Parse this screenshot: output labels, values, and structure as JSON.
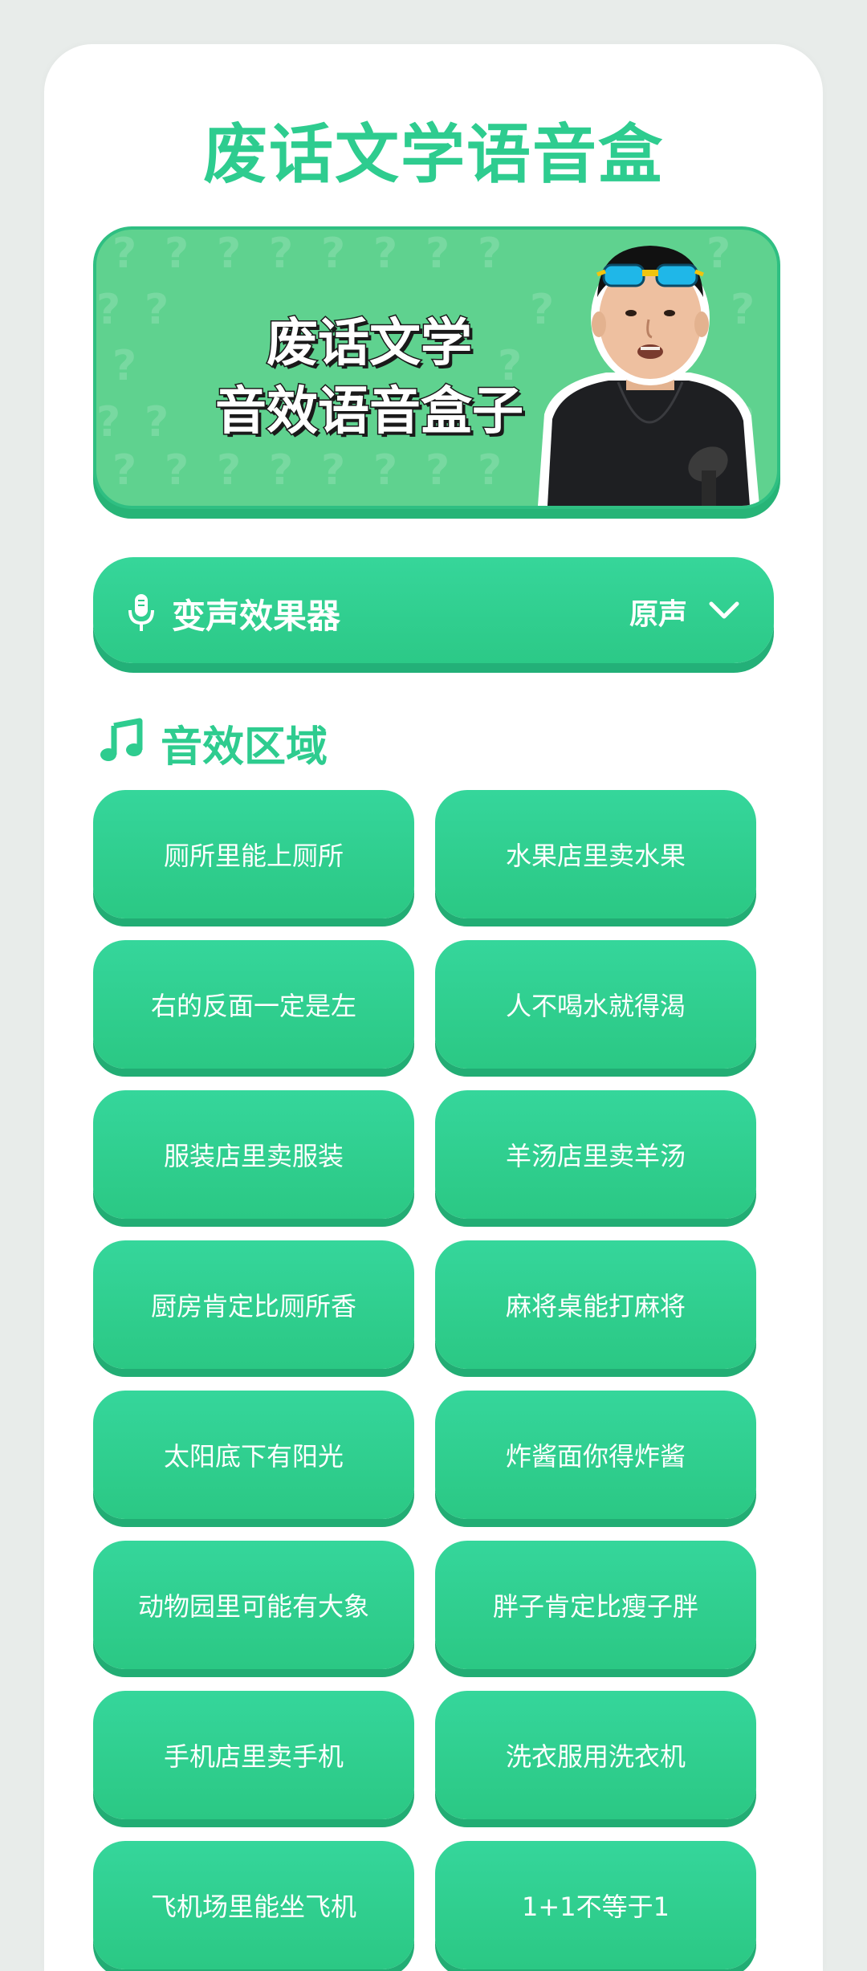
{
  "header": {
    "title": "废话文学语音盒"
  },
  "banner": {
    "line1": "废话文学",
    "line2": "音效语音盒子"
  },
  "voice_changer": {
    "label": "变声效果器",
    "value": "原声",
    "icon": "microphone-icon",
    "dropdown_icon": "chevron-down-icon"
  },
  "section": {
    "title": "音效区域",
    "icon": "music-note-icon"
  },
  "sounds": [
    "厕所里能上厕所",
    "水果店里卖水果",
    "右的反面一定是左",
    "人不喝水就得渴",
    "服装店里卖服装",
    "羊汤店里卖羊汤",
    "厨房肯定比厕所香",
    "麻将桌能打麻将",
    "太阳底下有阳光",
    "炸酱面你得炸酱",
    "动物园里可能有大象",
    "胖子肯定比瘦子胖",
    "手机店里卖手机",
    "洗衣服用洗衣机",
    "飞机场里能坐飞机",
    "1+1不等于1"
  ],
  "colors": {
    "accent": "#2ecc8f",
    "button": "#31d092",
    "button_shadow": "#22ad74",
    "background": "#e8ecea",
    "card": "#ffffff"
  }
}
